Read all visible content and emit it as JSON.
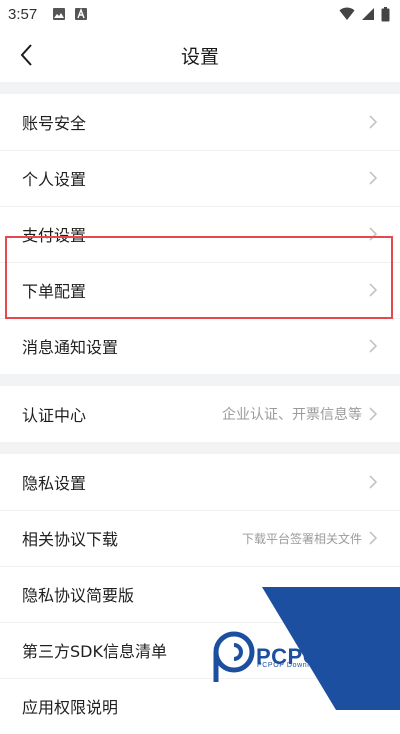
{
  "status_bar": {
    "time": "3:57",
    "notification_icons": [
      "image-icon",
      "a-badge-icon"
    ],
    "system_icons": [
      "wifi-icon",
      "signal-icon",
      "battery-icon"
    ]
  },
  "header": {
    "title": "设置",
    "back_icon": "chevron-left-icon"
  },
  "groups": [
    {
      "items": [
        {
          "label": "账号安全"
        },
        {
          "label": "个人设置"
        },
        {
          "label": "支付设置"
        },
        {
          "label": "下单配置",
          "highlighted": true
        },
        {
          "label": "消息通知设置"
        }
      ]
    },
    {
      "items": [
        {
          "label": "认证中心",
          "hint": "企业认证、开票信息等"
        }
      ]
    },
    {
      "items": [
        {
          "label": "隐私设置"
        },
        {
          "label": "相关协议下载",
          "hint": "下载平台签署相关文件"
        },
        {
          "label": "隐私协议简要版"
        },
        {
          "label": "第三方SDK信息清单"
        },
        {
          "label": "应用权限说明"
        }
      ]
    }
  ],
  "highlight_color": "#e8474c",
  "watermark": {
    "text": "PCPOP下载",
    "subtext": "PCPOP Download",
    "color": "#1c4fa0"
  }
}
